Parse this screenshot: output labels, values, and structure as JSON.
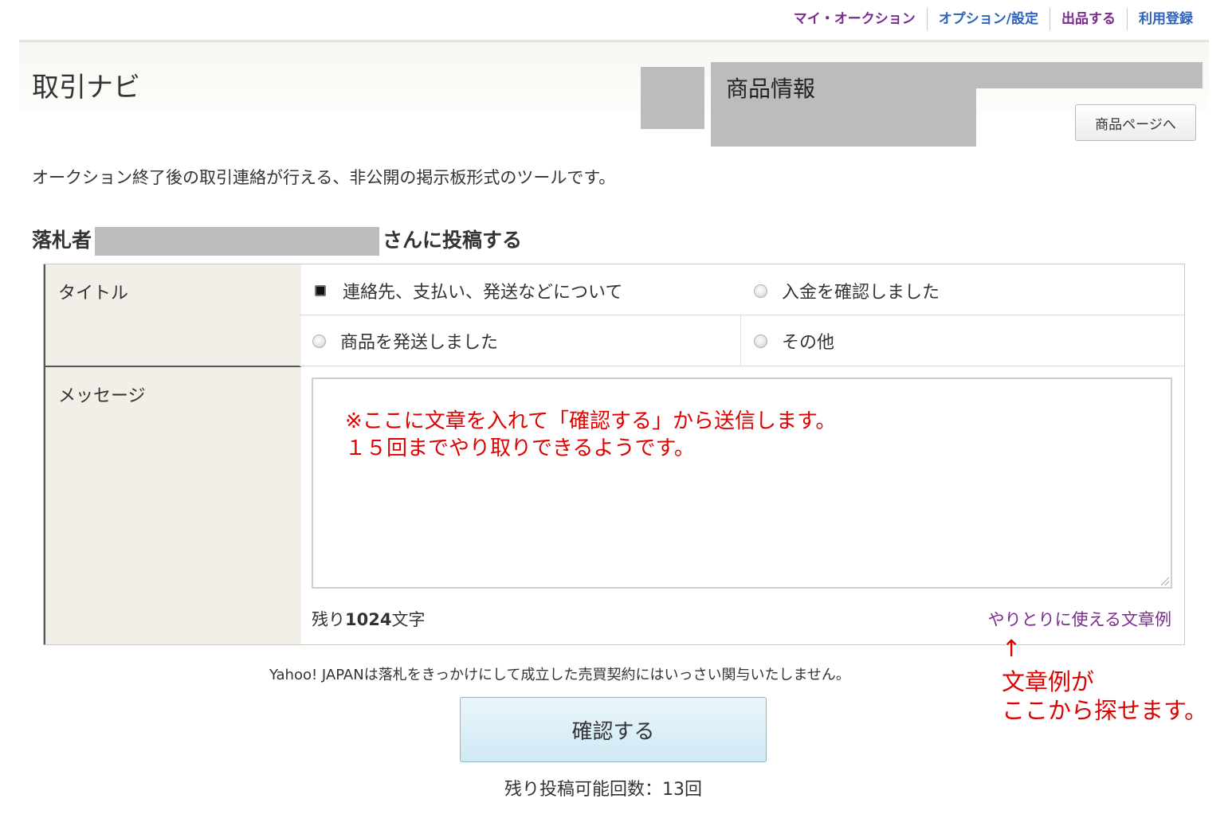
{
  "topnav": {
    "my_auction": "マイ・オークション",
    "options": "オプション/設定",
    "sell": "出品する",
    "register": "利用登録"
  },
  "header": {
    "title": "取引ナビ",
    "item_info": "商品情報",
    "item_page_button": "商品ページへ"
  },
  "description": "オークション終了後の取引連絡が行える、非公開の掲示板形式のツールです。",
  "post_heading": {
    "prefix": "落札者",
    "suffix": "さんに投稿する"
  },
  "form": {
    "title_label": "タイトル",
    "message_label": "メッセージ",
    "options": [
      {
        "label": "連絡先、支払い、発送などについて",
        "selected": true
      },
      {
        "label": "入金を確認しました",
        "selected": false
      },
      {
        "label": "商品を発送しました",
        "selected": false
      },
      {
        "label": "その他",
        "selected": false
      }
    ],
    "message_lines": [
      "※ここに文章を入れて「確認する」から送信します。",
      "１５回までやり取りできるようです。"
    ],
    "remaining_prefix": "残り",
    "remaining_count": "1024",
    "remaining_suffix": "文字",
    "example_link": "やりとりに使える文章例"
  },
  "disclaimer": "Yahoo! JAPANは落札をきっかけにして成立した売買契約にはいっさい関与いたしません。",
  "confirm_button": "確認する",
  "post_count": "残り投稿可能回数：13回",
  "annotation": {
    "arrow": "↑",
    "line1": "文章例が",
    "line2": "ここから探せます。"
  },
  "colors": {
    "link_purple": "#7a2b8e",
    "link_blue": "#2d63b8",
    "annotation_red": "#e00000",
    "label_bg": "#f1efe8"
  }
}
